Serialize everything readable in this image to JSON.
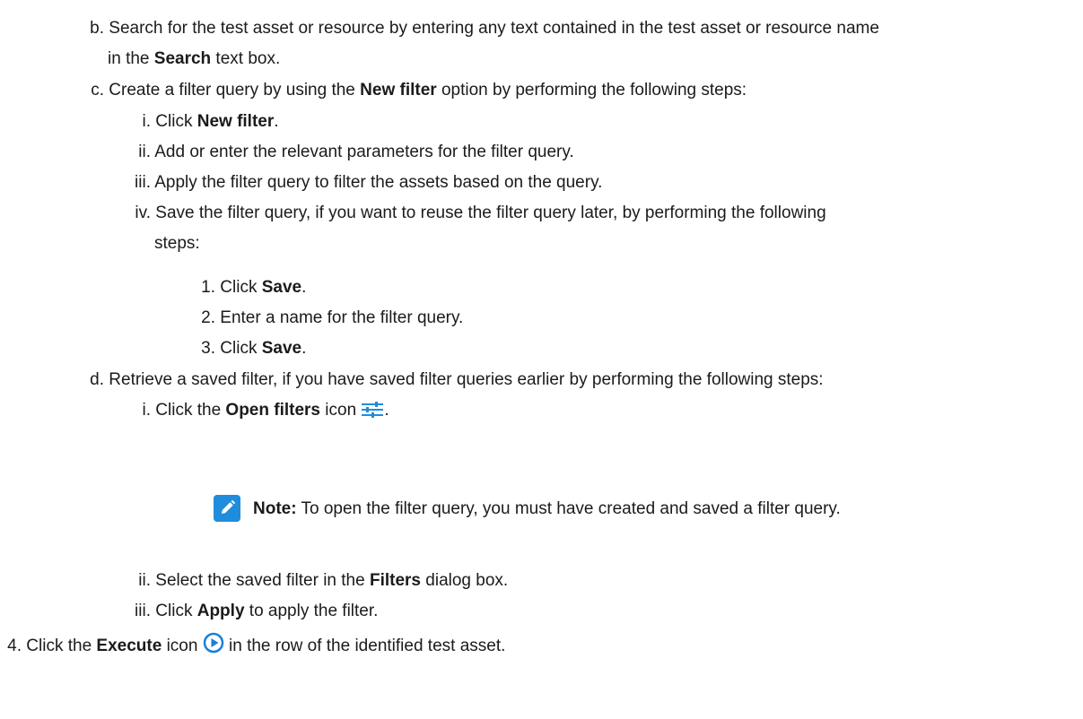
{
  "colors": {
    "text": "#1b1b1b",
    "accent": "#1f8ddb",
    "execute_icon": "#1a7fd6"
  },
  "icons": [
    "open-filters-icon",
    "note-icon",
    "execute-icon"
  ],
  "steps": {
    "b": {
      "marker": "b.",
      "line1": "Search for the test asset or resource by entering any text contained in the test asset or resource name",
      "pre": "in the ",
      "bold": "Search",
      "post": " text box."
    },
    "c": {
      "marker": "c.",
      "pre": "Create a filter query by using the ",
      "bold": "New filter",
      "post": " option by performing the following steps:",
      "i": {
        "marker": "i.",
        "pre": "Click ",
        "bold": "New filter",
        "post": "."
      },
      "ii": {
        "marker": "ii.",
        "text": "Add or enter the relevant parameters for the filter query."
      },
      "iii": {
        "marker": "iii.",
        "text": "Apply the filter query to filter the assets based on the query."
      },
      "iv": {
        "marker": "iv.",
        "line1": "Save the filter query, if you want to reuse the filter query later, by performing the following",
        "line2": "steps:",
        "s1": {
          "marker": "1.",
          "pre": "Click ",
          "bold": "Save",
          "post": "."
        },
        "s2": {
          "marker": "2.",
          "text": "Enter a name for the filter query."
        },
        "s3": {
          "marker": "3.",
          "pre": "Click ",
          "bold": "Save",
          "post": "."
        }
      }
    },
    "d": {
      "marker": "d.",
      "text": "Retrieve a saved filter, if you have saved filter queries earlier by performing the following steps:",
      "i": {
        "marker": "i.",
        "pre": "Click the ",
        "bold": "Open filters",
        "post": " icon",
        "end": "."
      },
      "note": {
        "label": "Note:",
        "text": " To open the filter query, you must have created and saved a filter query."
      },
      "ii": {
        "marker": "ii.",
        "pre": "Select the saved filter in the ",
        "bold": "Filters",
        "post": " dialog box."
      },
      "iii": {
        "marker": "iii.",
        "pre": "Click ",
        "bold": "Apply",
        "post": " to apply the filter."
      }
    },
    "four": {
      "marker": "4.",
      "pre": "Click the ",
      "bold": "Execute",
      "post": " icon",
      "post2": " in the row of the identified test asset."
    }
  }
}
